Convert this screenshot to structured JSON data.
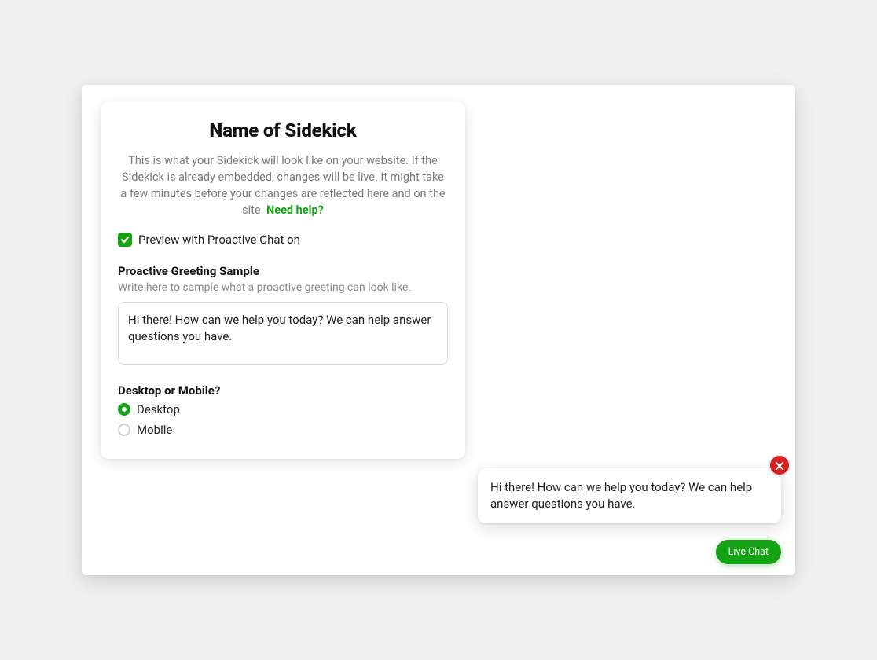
{
  "card": {
    "title": "Name of Sidekick",
    "description": "This is what your Sidekick will look like on your website. If the Sidekick is already embedded, changes will be live. It might take a few minutes before your changes are reflected here and on the site. ",
    "help_link": "Need help?",
    "preview_checkbox_label": "Preview with Proactive Chat on",
    "preview_checked": true,
    "greeting": {
      "label": "Proactive Greeting Sample",
      "help": "Write here to sample what a proactive greeting can look like.",
      "value": "Hi there! How can we help you today? We can help answer questions you have."
    },
    "device": {
      "label": "Desktop or Mobile?",
      "options": [
        {
          "label": "Desktop",
          "selected": true
        },
        {
          "label": "Mobile",
          "selected": false
        }
      ]
    }
  },
  "chat": {
    "message": "Hi there! How can we help you today? We can help answer questions you have.",
    "button_label": "Live Chat"
  }
}
